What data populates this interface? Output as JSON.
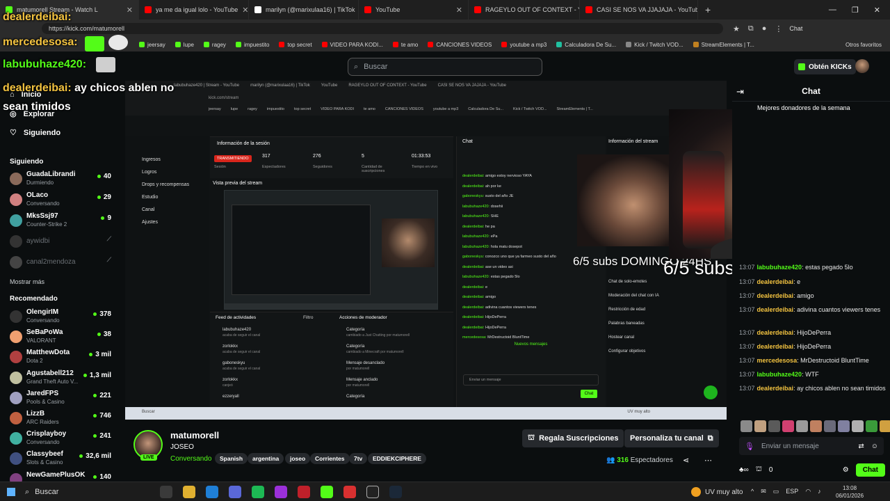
{
  "browser": {
    "tabs": [
      {
        "label": "matumorell Stream - Watch L",
        "color": "#53fc18"
      },
      {
        "label": "ya me da igual lolo - YouTube",
        "color": "#ff0000"
      },
      {
        "label": "marilyn (@marixulaa16) | TikTok",
        "color": "#ffffff"
      },
      {
        "label": "YouTube",
        "color": "#ff0000"
      },
      {
        "label": "RAGEYLO OUT OF CONTEXT - You",
        "color": "#ff0000"
      },
      {
        "label": "CASI SE NOS VA JJAJAJA - YouTub",
        "color": "#ff0000"
      }
    ],
    "url": "https://kick.com/matumorell",
    "chat_chip": "Chat",
    "bookmarks": [
      {
        "label": "jeersay",
        "color": "#53fc18"
      },
      {
        "label": "lupe",
        "color": "#53fc18"
      },
      {
        "label": "ragey",
        "color": "#53fc18"
      },
      {
        "label": "impuestito",
        "color": "#53fc18"
      },
      {
        "label": "top secret",
        "color": "#ff0000"
      },
      {
        "label": "VIDEO PARA KODI...",
        "color": "#ff0000"
      },
      {
        "label": "te amo",
        "color": "#ff0000"
      },
      {
        "label": "CANCIONES VIDEOS",
        "color": "#ff0000"
      },
      {
        "label": "youtube a mp3",
        "color": "#ff0000"
      },
      {
        "label": "Calculadora De Su...",
        "color": "#20c0a0"
      },
      {
        "label": "Kick / Twitch VOD...",
        "color": "#888888"
      },
      {
        "label": "StreamElements | T...",
        "color": "#c08020"
      }
    ],
    "bookmarks_other": "Otros favoritos"
  },
  "header": {
    "search_placeholder": "Buscar",
    "kicks_button": "Obtén KICKs"
  },
  "overlay_chat": [
    {
      "user": "dealerdeibai:",
      "text": "",
      "color": "#f3c340"
    },
    {
      "user": "mercedesosa:",
      "text": "",
      "color": "#f3c340"
    },
    {
      "user": "labubuhaze420:",
      "text": "",
      "color": "#53fc18"
    },
    {
      "user": "dealerdeibai:",
      "text": "ay chicos ablen no",
      "color": "#f3c340"
    },
    {
      "user": "",
      "text": "sean timidos",
      "color": "#ffffff"
    }
  ],
  "sidebar": {
    "nav": [
      {
        "label": "Inicio"
      },
      {
        "label": "Explorar"
      },
      {
        "label": "Siguiendo"
      }
    ],
    "following_heading": "Siguiendo",
    "following": [
      {
        "name": "GuadaLibrandi",
        "sub": "Durmiendo",
        "count": "40",
        "color": "#8a6a5a"
      },
      {
        "name": "OLaco",
        "sub": "Conversando",
        "count": "29",
        "color": "#d08080"
      },
      {
        "name": "MksSsj97",
        "sub": "Counter-Strike 2",
        "count": "9",
        "color": "#40a0a0"
      },
      {
        "name": "aywidbi",
        "sub": "",
        "count": "⟋",
        "color": "#333"
      },
      {
        "name": "canal2mendoza",
        "sub": "",
        "count": "⟋",
        "color": "#444"
      }
    ],
    "show_more": "Mostrar más",
    "recommended_heading": "Recomendado",
    "recommended": [
      {
        "name": "OlengirIM",
        "sub": "Conversando",
        "count": "378",
        "color": "#333"
      },
      {
        "name": "SeBaPoWa",
        "sub": "VALORANT",
        "count": "38",
        "color": "#f0a070"
      },
      {
        "name": "MatthewDota",
        "sub": "Dota 2",
        "count": "3 mil",
        "color": "#b04040"
      },
      {
        "name": "Agustabell212",
        "sub": "Grand Theft Auto V...",
        "count": "1,3 mil",
        "color": "#c0c0a0"
      },
      {
        "name": "JaredFPS",
        "sub": "Pools & Casino",
        "count": "221",
        "color": "#a0a0c0"
      },
      {
        "name": "LizzB",
        "sub": "ARC Raiders",
        "count": "746",
        "color": "#c06040"
      },
      {
        "name": "Crisplayboy",
        "sub": "Conversando",
        "count": "241",
        "color": "#40b0a0"
      },
      {
        "name": "Classybeef",
        "sub": "Slots & Casino",
        "count": "32,6 mil",
        "color": "#405080"
      },
      {
        "name": "NewGamePlusOK",
        "sub": "",
        "count": "140",
        "color": "#804080"
      }
    ]
  },
  "stream_inner": {
    "tabs": [
      "labubuhaze420 | Stream - YouTube",
      "marilyn (@marixulaa16) | TikTok",
      "YouTube",
      "RAGEYLO OUT OF CONTEXT - YouTube",
      "CASI SE NOS VA JAJAJA - YouTube"
    ],
    "url": "kick.com/stream",
    "bookmarks": [
      "jeersay",
      "lupe",
      "ragey",
      "impuestito",
      "top secret",
      "VIDEO PARA KODI",
      "te amo",
      "CANCIONES VIDEOS",
      "youtube a mp3",
      "Calculadora De Su...",
      "Kick / Twitch VOD...",
      "StreamElements | T..."
    ],
    "dash_items": [
      "Ingresos",
      "Logros",
      "Drops y recompensas",
      "Estudio",
      "Canal",
      "Ajustes"
    ],
    "session_title": "Información de la sesión",
    "live_tag": "TRANSMITIENDO",
    "session_label": "Sesión",
    "stats": [
      {
        "value": "317",
        "label": "Espectadores"
      },
      {
        "value": "276",
        "label": "Seguidores"
      },
      {
        "value": "5",
        "label": "Cantidad de suscripciones"
      },
      {
        "value": "01:33:53",
        "label": "Tiempo en vivo"
      }
    ],
    "preview_title": "Vista previa del stream",
    "feed_title": "Feed de actividades",
    "feed_filter": "Filtro",
    "mod_title": "Acciones de moderador",
    "feed_rows": [
      {
        "name": "labubuhaze420",
        "sub": "acaba de seguir el canal"
      },
      {
        "name": "zorlokkx",
        "sub": "acaba de seguir el canal"
      },
      {
        "name": "gaboneskyu",
        "sub": "acaba de seguir el canal"
      },
      {
        "name": "zorlokkx",
        "sub": "canjeó"
      },
      {
        "name": "ezzeryall",
        "sub": ""
      }
    ],
    "mod_rows": [
      {
        "name": "Categoría",
        "sub": "cambiado a Just Chatting por matumorell"
      },
      {
        "name": "Categoría",
        "sub": "cambiado a Minecraft por matumorell"
      },
      {
        "name": "Mensaje desanclado",
        "sub": "por matumorell"
      },
      {
        "name": "Mensaje anclado",
        "sub": "por matumorell"
      },
      {
        "name": "Categoría",
        "sub": ""
      }
    ],
    "chat_title": "Chat",
    "chat_lines": [
      {
        "user": "dealerdeibai:",
        "text": "amigo estoy nervioso YAYA"
      },
      {
        "user": "dealerdeibai:",
        "text": "ah por ke"
      },
      {
        "user": "gaboneskyu:",
        "text": "susto del año JE"
      },
      {
        "user": "labubuhaze420:",
        "text": "dosehii"
      },
      {
        "user": "labubuhaze420:",
        "text": "SHE"
      },
      {
        "user": "dealerdeibai:",
        "text": "he pa"
      },
      {
        "user": "labubuhaze420:",
        "text": "ePa"
      },
      {
        "user": "labubuhaze420:",
        "text": "hola matu dosepot"
      },
      {
        "user": "gaboneskyu:",
        "text": "conozco uno que ya farmeo susto del año"
      },
      {
        "user": "dealerdeibai:",
        "text": "ase un video asi"
      },
      {
        "user": "labubuhaze420:",
        "text": "estas pegado 5lo"
      },
      {
        "user": "dealerdeibai:",
        "text": "e"
      },
      {
        "user": "dealerdeibai:",
        "text": "amigo"
      },
      {
        "user": "dealerdeibai:",
        "text": "adivina cuantos viewers tenes"
      },
      {
        "user": "dealerdeibai:",
        "text": "HijoDePerra"
      },
      {
        "user": "dealerdeibai:",
        "text": "HijoDePerra"
      },
      {
        "user": "mercedesosa:",
        "text": "MrDestructoid BluntTime"
      }
    ],
    "new_messages": "Nuevos mensajes",
    "chat_input": "Enviar un mensaje",
    "chat_button": "Chat",
    "info_title": "Información del stream",
    "info_items": [
      "Chat de solo-emotes",
      "Moderación del chat con IA",
      "Restricción de edad",
      "Palabras baneadas",
      "Hostear canal",
      "Configurar objetivos"
    ],
    "subs_overlay": "6/5 subs DOMINGO 24HS",
    "taskbar_search": "Buscar",
    "taskbar_weather": "UV muy alto"
  },
  "webcam_overlay": "6/5 subs DOMINGO 24HS",
  "chat": {
    "title": "Chat",
    "donors_label": "Mejores donadores de la semana",
    "messages": [
      {
        "time": "13:07",
        "user": "labubuhaze420",
        "text": "estas pegado 5lo",
        "color": "#53fc18"
      },
      {
        "time": "13:07",
        "user": "dealerdeibai",
        "text": "e",
        "color": "#f3c340"
      },
      {
        "time": "13:07",
        "user": "dealerdeibai",
        "text": "amigo",
        "color": "#f3c340"
      },
      {
        "time": "13:07",
        "user": "dealerdeibai",
        "text": "adivina cuantos viewers tenes",
        "color": "#f3c340"
      },
      {
        "time": "13:07",
        "user": "dealerdeibai",
        "text": "HijoDePerra",
        "color": "#f3c340"
      },
      {
        "time": "13:07",
        "user": "dealerdeibai",
        "text": "HijoDePerra",
        "color": "#f3c340"
      },
      {
        "time": "13:07",
        "user": "mercedesosa",
        "text": "MrDestructoid BluntTime",
        "color": "#f3c340"
      },
      {
        "time": "13:07",
        "user": "labubuhaze420",
        "text": "WTF",
        "color": "#53fc18"
      },
      {
        "time": "13:07",
        "user": "dealerdeibai",
        "text": "ay chicos ablen no sean timidos",
        "color": "#f3c340"
      }
    ],
    "input_placeholder": "Enviar un mensaje",
    "points": "0",
    "send_label": "Chat"
  },
  "channel": {
    "name": "matumorell",
    "live_label": "LIVE",
    "title": "JOSEO",
    "category": "Conversando",
    "tags": [
      "Spanish",
      "argentina",
      "joseo",
      "Corrientes",
      "7tv",
      "EDDIEKCIPHERE"
    ],
    "subscribe_button": "Regala Suscripciones",
    "customize_button": "Personaliza tu canal",
    "viewers_value": "316",
    "viewers_label": "Espectadores"
  },
  "taskbar": {
    "search": "Buscar",
    "weather": "UV muy alto",
    "lang": "ESP",
    "time": "13:08",
    "date": "06/01/2026"
  }
}
